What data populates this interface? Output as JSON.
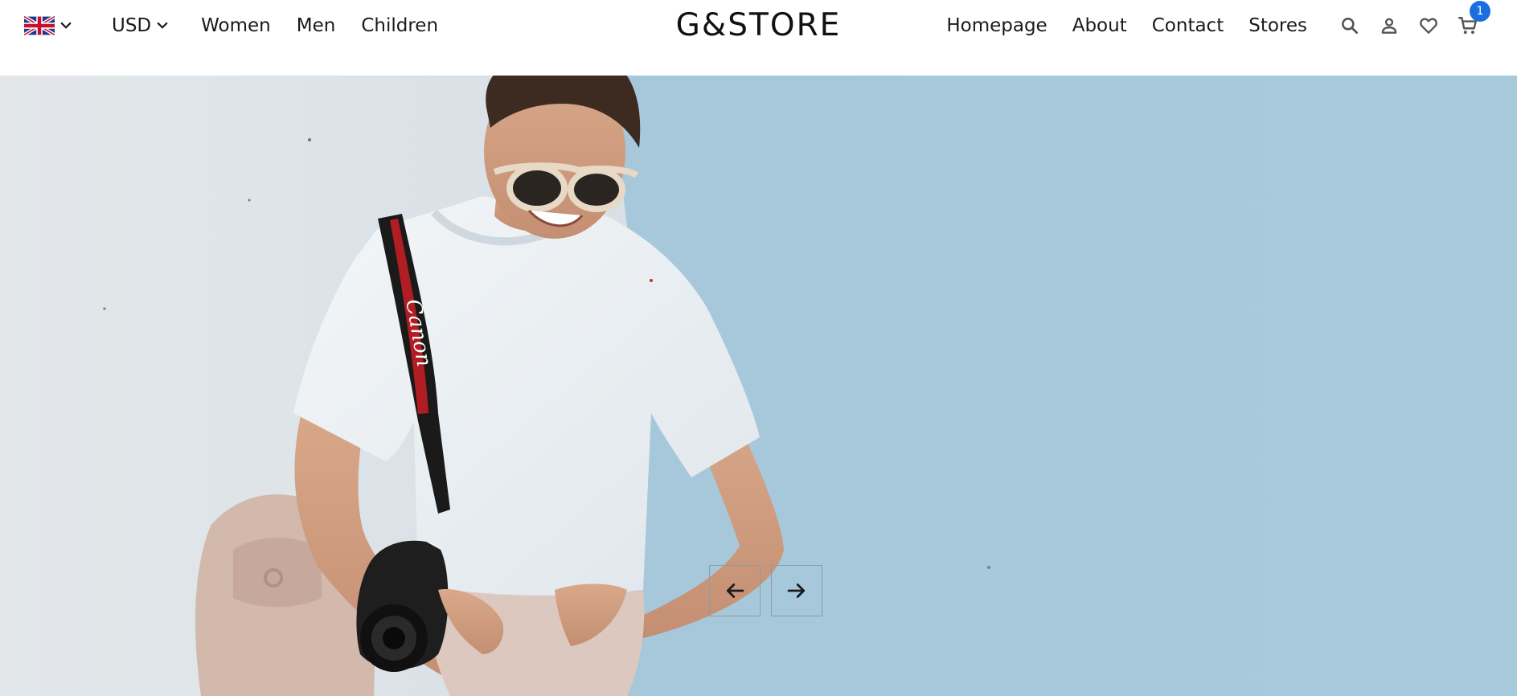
{
  "header": {
    "language": {
      "flag_icon": "uk-flag-icon",
      "chevron_icon": "chevron-down-icon"
    },
    "currency": {
      "label": "USD",
      "chevron_icon": "chevron-down-icon"
    },
    "categories": [
      {
        "label": "Women"
      },
      {
        "label": "Men"
      },
      {
        "label": "Children"
      }
    ],
    "logo": "G&STORE",
    "pages": [
      {
        "label": "Homepage"
      },
      {
        "label": "About"
      },
      {
        "label": "Contact"
      },
      {
        "label": "Stores"
      }
    ],
    "icons": {
      "search": "search-icon",
      "account": "user-icon",
      "wishlist": "heart-icon",
      "cart": "cart-icon"
    },
    "cart_count": "1"
  },
  "hero": {
    "image": "woman-with-camera-hero-image",
    "prev_icon": "arrow-left-icon",
    "next_icon": "arrow-right-icon"
  },
  "colors": {
    "badge": "#1a6fe0",
    "wall_blue": "#a9c9dc",
    "wall_white": "#e4e8eb",
    "text": "#1a1a1a"
  }
}
